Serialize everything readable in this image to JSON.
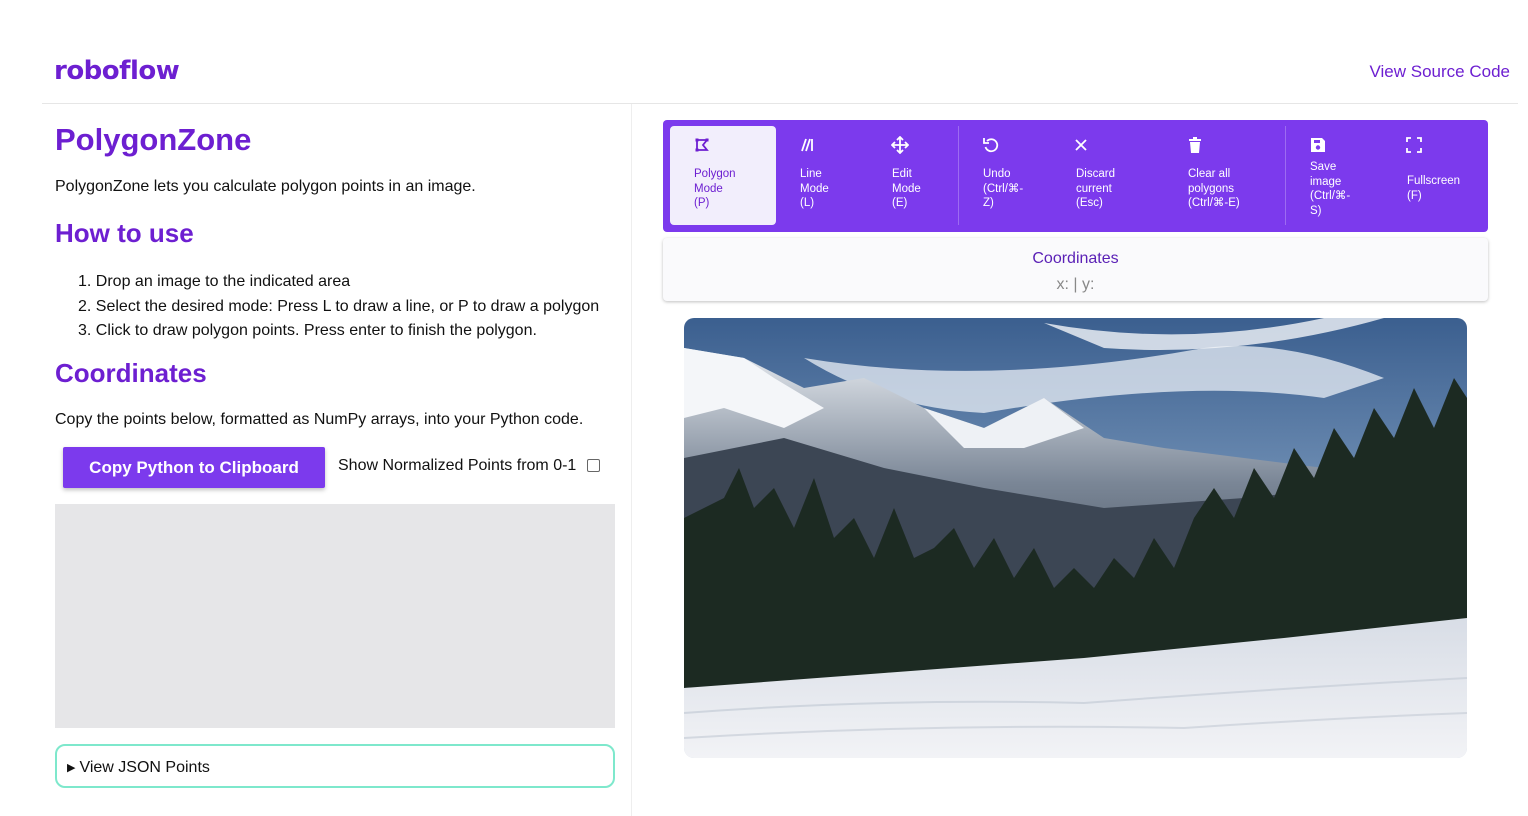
{
  "header": {
    "logo": "roboflow",
    "source_link": "View Source Code"
  },
  "intro": {
    "title": "PolygonZone",
    "lead": "PolygonZone lets you calculate polygon points in an image."
  },
  "howto": {
    "title": "How to use",
    "steps": [
      "1. Drop an image to the indicated area",
      "2. Select the desired mode: Press L to draw a line, or P to draw a polygon",
      "3. Click to draw polygon points. Press enter to finish the polygon."
    ]
  },
  "coordinates_section": {
    "title": "Coordinates",
    "description": "Copy the points below, formatted as NumPy arrays, into your Python code.",
    "copy_button": "Copy Python to Clipboard",
    "normalized_label": "Show Normalized Points from 0-1",
    "json_points": "View JSON Points"
  },
  "toolbar": {
    "tools": [
      {
        "label": "Polygon\nMode\n(P)",
        "icon": "polygon-icon",
        "active": true
      },
      {
        "label": "Line\nMode\n(L)",
        "icon": "line-icon",
        "active": false
      },
      {
        "label": "Edit\nMode\n(E)",
        "icon": "move-icon",
        "active": false
      },
      {
        "label": "Undo\n(Ctrl/⌘-\nZ)",
        "icon": "undo-icon",
        "active": false
      },
      {
        "label": "Discard\ncurrent\n(Esc)",
        "icon": "close-icon",
        "active": false
      },
      {
        "label": "Clear all\npolygons\n(Ctrl/⌘-E)",
        "icon": "trash-icon",
        "active": false
      },
      {
        "label": "Save\nimage\n(Ctrl/⌘-\nS)",
        "icon": "save-icon",
        "active": false
      },
      {
        "label": "Fullscreen\n(F)",
        "icon": "fullscreen-icon",
        "active": false
      }
    ]
  },
  "coord_display": {
    "title": "Coordinates",
    "value": "x: | y:"
  },
  "colors": {
    "brand": "#6d1fd1",
    "toolbar": "#7c3aed",
    "json_border": "#7ee8cc"
  }
}
